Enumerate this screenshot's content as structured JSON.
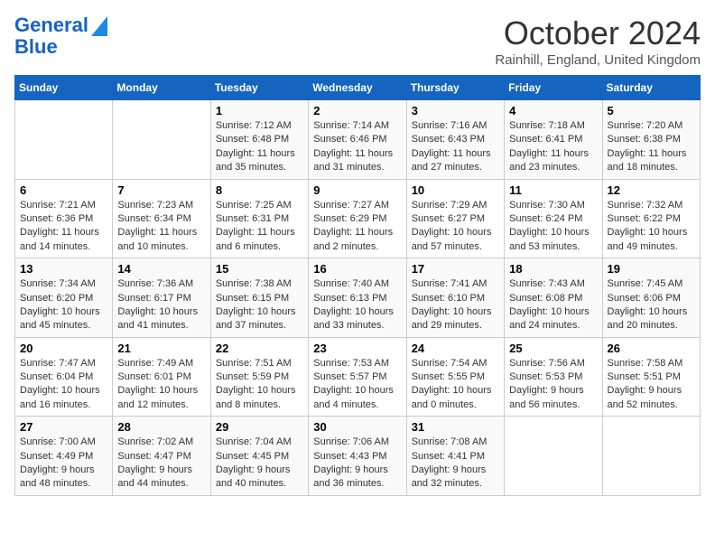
{
  "header": {
    "logo_line1": "General",
    "logo_line2": "Blue",
    "month": "October 2024",
    "location": "Rainhill, England, United Kingdom"
  },
  "weekdays": [
    "Sunday",
    "Monday",
    "Tuesday",
    "Wednesday",
    "Thursday",
    "Friday",
    "Saturday"
  ],
  "weeks": [
    [
      {
        "day": "",
        "sunrise": "",
        "sunset": "",
        "daylight": ""
      },
      {
        "day": "",
        "sunrise": "",
        "sunset": "",
        "daylight": ""
      },
      {
        "day": "1",
        "sunrise": "Sunrise: 7:12 AM",
        "sunset": "Sunset: 6:48 PM",
        "daylight": "Daylight: 11 hours and 35 minutes."
      },
      {
        "day": "2",
        "sunrise": "Sunrise: 7:14 AM",
        "sunset": "Sunset: 6:46 PM",
        "daylight": "Daylight: 11 hours and 31 minutes."
      },
      {
        "day": "3",
        "sunrise": "Sunrise: 7:16 AM",
        "sunset": "Sunset: 6:43 PM",
        "daylight": "Daylight: 11 hours and 27 minutes."
      },
      {
        "day": "4",
        "sunrise": "Sunrise: 7:18 AM",
        "sunset": "Sunset: 6:41 PM",
        "daylight": "Daylight: 11 hours and 23 minutes."
      },
      {
        "day": "5",
        "sunrise": "Sunrise: 7:20 AM",
        "sunset": "Sunset: 6:38 PM",
        "daylight": "Daylight: 11 hours and 18 minutes."
      }
    ],
    [
      {
        "day": "6",
        "sunrise": "Sunrise: 7:21 AM",
        "sunset": "Sunset: 6:36 PM",
        "daylight": "Daylight: 11 hours and 14 minutes."
      },
      {
        "day": "7",
        "sunrise": "Sunrise: 7:23 AM",
        "sunset": "Sunset: 6:34 PM",
        "daylight": "Daylight: 11 hours and 10 minutes."
      },
      {
        "day": "8",
        "sunrise": "Sunrise: 7:25 AM",
        "sunset": "Sunset: 6:31 PM",
        "daylight": "Daylight: 11 hours and 6 minutes."
      },
      {
        "day": "9",
        "sunrise": "Sunrise: 7:27 AM",
        "sunset": "Sunset: 6:29 PM",
        "daylight": "Daylight: 11 hours and 2 minutes."
      },
      {
        "day": "10",
        "sunrise": "Sunrise: 7:29 AM",
        "sunset": "Sunset: 6:27 PM",
        "daylight": "Daylight: 10 hours and 57 minutes."
      },
      {
        "day": "11",
        "sunrise": "Sunrise: 7:30 AM",
        "sunset": "Sunset: 6:24 PM",
        "daylight": "Daylight: 10 hours and 53 minutes."
      },
      {
        "day": "12",
        "sunrise": "Sunrise: 7:32 AM",
        "sunset": "Sunset: 6:22 PM",
        "daylight": "Daylight: 10 hours and 49 minutes."
      }
    ],
    [
      {
        "day": "13",
        "sunrise": "Sunrise: 7:34 AM",
        "sunset": "Sunset: 6:20 PM",
        "daylight": "Daylight: 10 hours and 45 minutes."
      },
      {
        "day": "14",
        "sunrise": "Sunrise: 7:36 AM",
        "sunset": "Sunset: 6:17 PM",
        "daylight": "Daylight: 10 hours and 41 minutes."
      },
      {
        "day": "15",
        "sunrise": "Sunrise: 7:38 AM",
        "sunset": "Sunset: 6:15 PM",
        "daylight": "Daylight: 10 hours and 37 minutes."
      },
      {
        "day": "16",
        "sunrise": "Sunrise: 7:40 AM",
        "sunset": "Sunset: 6:13 PM",
        "daylight": "Daylight: 10 hours and 33 minutes."
      },
      {
        "day": "17",
        "sunrise": "Sunrise: 7:41 AM",
        "sunset": "Sunset: 6:10 PM",
        "daylight": "Daylight: 10 hours and 29 minutes."
      },
      {
        "day": "18",
        "sunrise": "Sunrise: 7:43 AM",
        "sunset": "Sunset: 6:08 PM",
        "daylight": "Daylight: 10 hours and 24 minutes."
      },
      {
        "day": "19",
        "sunrise": "Sunrise: 7:45 AM",
        "sunset": "Sunset: 6:06 PM",
        "daylight": "Daylight: 10 hours and 20 minutes."
      }
    ],
    [
      {
        "day": "20",
        "sunrise": "Sunrise: 7:47 AM",
        "sunset": "Sunset: 6:04 PM",
        "daylight": "Daylight: 10 hours and 16 minutes."
      },
      {
        "day": "21",
        "sunrise": "Sunrise: 7:49 AM",
        "sunset": "Sunset: 6:01 PM",
        "daylight": "Daylight: 10 hours and 12 minutes."
      },
      {
        "day": "22",
        "sunrise": "Sunrise: 7:51 AM",
        "sunset": "Sunset: 5:59 PM",
        "daylight": "Daylight: 10 hours and 8 minutes."
      },
      {
        "day": "23",
        "sunrise": "Sunrise: 7:53 AM",
        "sunset": "Sunset: 5:57 PM",
        "daylight": "Daylight: 10 hours and 4 minutes."
      },
      {
        "day": "24",
        "sunrise": "Sunrise: 7:54 AM",
        "sunset": "Sunset: 5:55 PM",
        "daylight": "Daylight: 10 hours and 0 minutes."
      },
      {
        "day": "25",
        "sunrise": "Sunrise: 7:56 AM",
        "sunset": "Sunset: 5:53 PM",
        "daylight": "Daylight: 9 hours and 56 minutes."
      },
      {
        "day": "26",
        "sunrise": "Sunrise: 7:58 AM",
        "sunset": "Sunset: 5:51 PM",
        "daylight": "Daylight: 9 hours and 52 minutes."
      }
    ],
    [
      {
        "day": "27",
        "sunrise": "Sunrise: 7:00 AM",
        "sunset": "Sunset: 4:49 PM",
        "daylight": "Daylight: 9 hours and 48 minutes."
      },
      {
        "day": "28",
        "sunrise": "Sunrise: 7:02 AM",
        "sunset": "Sunset: 4:47 PM",
        "daylight": "Daylight: 9 hours and 44 minutes."
      },
      {
        "day": "29",
        "sunrise": "Sunrise: 7:04 AM",
        "sunset": "Sunset: 4:45 PM",
        "daylight": "Daylight: 9 hours and 40 minutes."
      },
      {
        "day": "30",
        "sunrise": "Sunrise: 7:06 AM",
        "sunset": "Sunset: 4:43 PM",
        "daylight": "Daylight: 9 hours and 36 minutes."
      },
      {
        "day": "31",
        "sunrise": "Sunrise: 7:08 AM",
        "sunset": "Sunset: 4:41 PM",
        "daylight": "Daylight: 9 hours and 32 minutes."
      },
      {
        "day": "",
        "sunrise": "",
        "sunset": "",
        "daylight": ""
      },
      {
        "day": "",
        "sunrise": "",
        "sunset": "",
        "daylight": ""
      }
    ]
  ]
}
